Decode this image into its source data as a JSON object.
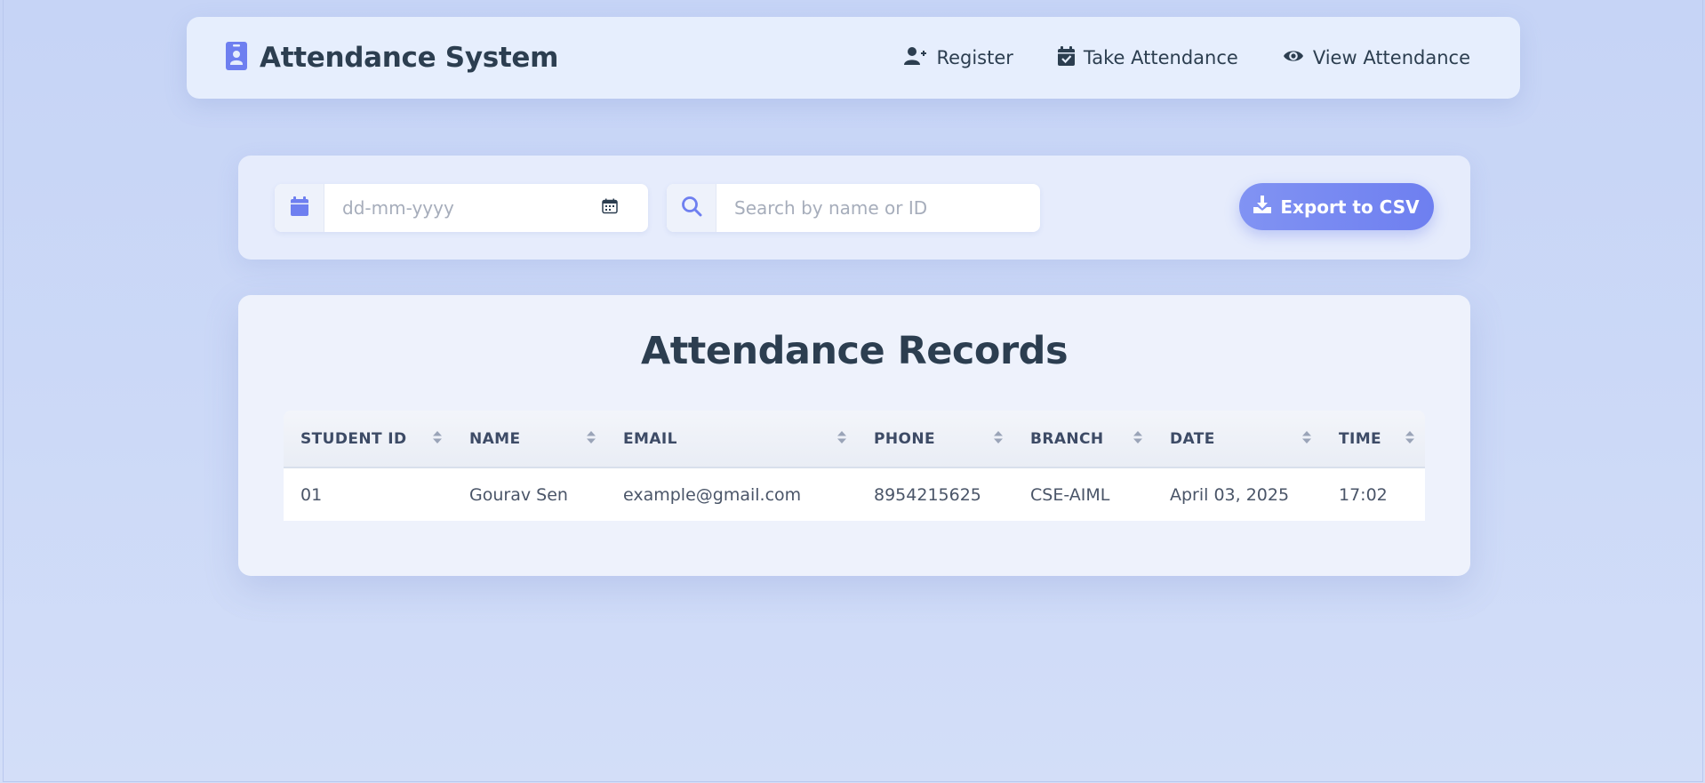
{
  "brand": {
    "title": "Attendance System",
    "icon": "id-badge-icon"
  },
  "nav": [
    {
      "label": "Register",
      "icon": "user-plus-icon"
    },
    {
      "label": "Take Attendance",
      "icon": "calendar-check-icon"
    },
    {
      "label": "View Attendance",
      "icon": "eye-icon"
    }
  ],
  "filters": {
    "date": {
      "placeholder": "dd-mm-yyyy",
      "value": ""
    },
    "search": {
      "placeholder": "Search by name or ID",
      "value": ""
    },
    "export_label": "Export to CSV"
  },
  "records": {
    "title": "Attendance Records",
    "columns": [
      "STUDENT ID",
      "NAME",
      "EMAIL",
      "PHONE",
      "BRANCH",
      "DATE",
      "TIME"
    ],
    "rows": [
      [
        "01",
        "Gourav Sen",
        "example@gmail.com",
        "8954215625",
        "CSE-AIML",
        "April 03, 2025",
        "17:02"
      ]
    ]
  },
  "colors": {
    "accent": "#6e7ff0",
    "text_dark": "#2c3e50",
    "background": "#c6d4f6"
  }
}
